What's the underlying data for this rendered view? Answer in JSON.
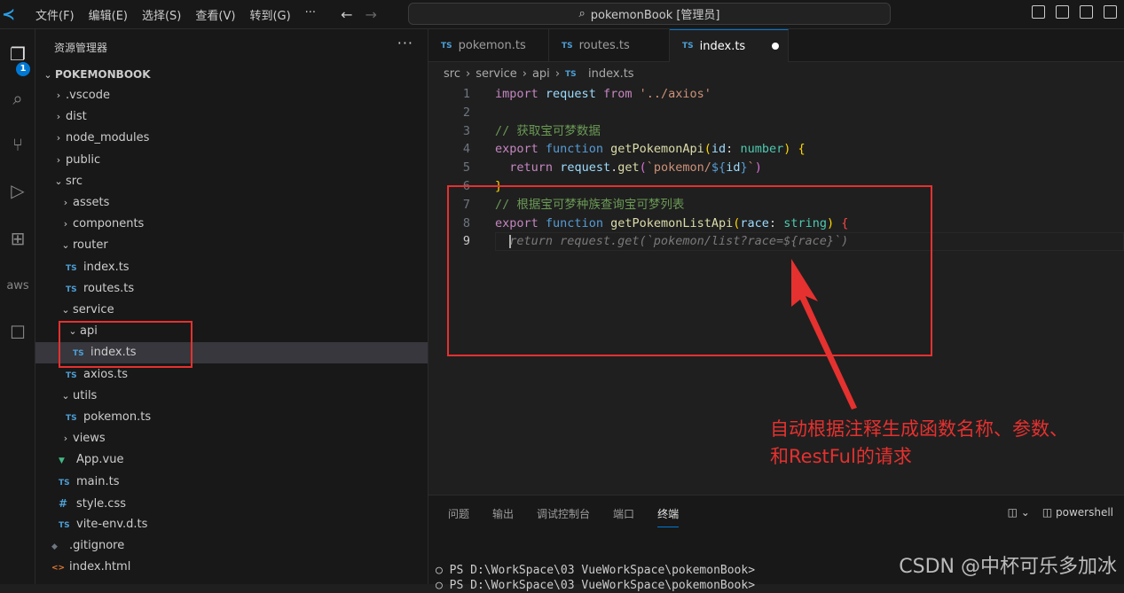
{
  "titlebar": {
    "menu": [
      "文件(F)",
      "编辑(E)",
      "选择(S)",
      "查看(V)",
      "转到(G)",
      "···"
    ],
    "search": "pokemonBook [管理员]"
  },
  "activity": {
    "badge": "1",
    "items": [
      "files-icon",
      "search-icon",
      "source-control-icon",
      "run-debug-icon",
      "extensions-icon",
      "aws-icon",
      "chat-icon"
    ],
    "aws_label": "aws"
  },
  "sidebar": {
    "title": "资源管理器",
    "more": "···",
    "root": "POKEMONBOOK",
    "items": [
      {
        "label": ".vscode",
        "type": "folder",
        "depth": 0,
        "open": false
      },
      {
        "label": "dist",
        "type": "folder",
        "depth": 0,
        "open": false
      },
      {
        "label": "node_modules",
        "type": "folder",
        "depth": 0,
        "open": false
      },
      {
        "label": "public",
        "type": "folder",
        "depth": 0,
        "open": false
      },
      {
        "label": "src",
        "type": "folder",
        "depth": 0,
        "open": true
      },
      {
        "label": "assets",
        "type": "folder",
        "depth": 1,
        "open": false
      },
      {
        "label": "components",
        "type": "folder",
        "depth": 1,
        "open": false
      },
      {
        "label": "router",
        "type": "folder",
        "depth": 1,
        "open": true
      },
      {
        "label": "index.ts",
        "type": "ts",
        "depth": 2
      },
      {
        "label": "routes.ts",
        "type": "ts",
        "depth": 2
      },
      {
        "label": "service",
        "type": "folder",
        "depth": 1,
        "open": true
      },
      {
        "label": "api",
        "type": "folder",
        "depth": 2,
        "open": true
      },
      {
        "label": "index.ts",
        "type": "ts",
        "depth": 3,
        "selected": true
      },
      {
        "label": "axios.ts",
        "type": "ts",
        "depth": 2
      },
      {
        "label": "utils",
        "type": "folder",
        "depth": 1,
        "open": true
      },
      {
        "label": "pokemon.ts",
        "type": "ts",
        "depth": 2
      },
      {
        "label": "views",
        "type": "folder",
        "depth": 1,
        "open": false
      },
      {
        "label": "App.vue",
        "type": "vue",
        "depth": 1
      },
      {
        "label": "main.ts",
        "type": "ts",
        "depth": 1
      },
      {
        "label": "style.css",
        "type": "css",
        "depth": 1
      },
      {
        "label": "vite-env.d.ts",
        "type": "ts",
        "depth": 1
      },
      {
        "label": ".gitignore",
        "type": "git",
        "depth": 0
      },
      {
        "label": "index.html",
        "type": "html",
        "depth": 0
      }
    ]
  },
  "tabs": [
    {
      "label": "pokemon.ts",
      "icon": "TS"
    },
    {
      "label": "routes.ts",
      "icon": "TS"
    },
    {
      "label": "index.ts",
      "icon": "TS",
      "active": true,
      "modified": true
    }
  ],
  "breadcrumb": [
    "src",
    "service",
    "api",
    "index.ts"
  ],
  "code": {
    "lines": [
      [
        [
          "k",
          "import"
        ],
        [
          "w",
          " "
        ],
        [
          "v",
          "request"
        ],
        [
          "w",
          " "
        ],
        [
          "k",
          "from"
        ],
        [
          "w",
          " "
        ],
        [
          "s",
          "'../axios'"
        ]
      ],
      [],
      [
        [
          "c",
          "// 获取宝可梦数据"
        ]
      ],
      [
        [
          "k",
          "export"
        ],
        [
          "w",
          " "
        ],
        [
          "b",
          "function"
        ],
        [
          "w",
          " "
        ],
        [
          "f",
          "getPokemonApi"
        ],
        [
          "y",
          "("
        ],
        [
          "v",
          "id"
        ],
        [
          "w",
          ": "
        ],
        [
          "t",
          "number"
        ],
        [
          "y",
          ")"
        ],
        [
          "w",
          " "
        ],
        [
          "y",
          "{"
        ]
      ],
      [
        [
          "w",
          "  "
        ],
        [
          "k",
          "return"
        ],
        [
          "w",
          " "
        ],
        [
          "v",
          "request"
        ],
        [
          "w",
          "."
        ],
        [
          "f",
          "get"
        ],
        [
          "p",
          "("
        ],
        [
          "s",
          "`pokemon/"
        ],
        [
          "b",
          "${"
        ],
        [
          "v",
          "id"
        ],
        [
          "b",
          "}"
        ],
        [
          "s",
          "`"
        ],
        [
          "p",
          ")"
        ]
      ],
      [
        [
          "y",
          "}"
        ]
      ],
      [
        [
          "c",
          "// 根据宝可梦种族查询宝可梦列表"
        ]
      ],
      [
        [
          "k",
          "export"
        ],
        [
          "w",
          " "
        ],
        [
          "b",
          "function"
        ],
        [
          "w",
          " "
        ],
        [
          "f",
          "getPokemonListApi"
        ],
        [
          "y",
          "("
        ],
        [
          "v",
          "race"
        ],
        [
          "w",
          ": "
        ],
        [
          "t",
          "string"
        ],
        [
          "y",
          ")"
        ],
        [
          "w",
          " "
        ],
        [
          "r",
          "{"
        ]
      ],
      [
        [
          "ghost",
          "  return request.get(`pokemon/list?race=${race}`)"
        ]
      ]
    ],
    "current_line": 9
  },
  "annotation": [
    "自动根据注释生成函数名称、参数、",
    "和RestFul的请求"
  ],
  "panel": {
    "tabs": [
      "问题",
      "输出",
      "调试控制台",
      "端口",
      "终端"
    ],
    "active": "终端",
    "shell": "powershell",
    "terminal": [
      "PS D:\\WorkSpace\\03 VueWorkSpace\\pokemonBook>",
      "PS D:\\WorkSpace\\03 VueWorkSpace\\pokemonBook>"
    ]
  },
  "watermark": "CSDN @中杯可乐多加冰",
  "colors": {
    "accent": "#0078d4",
    "annotation": "#e5312f"
  }
}
